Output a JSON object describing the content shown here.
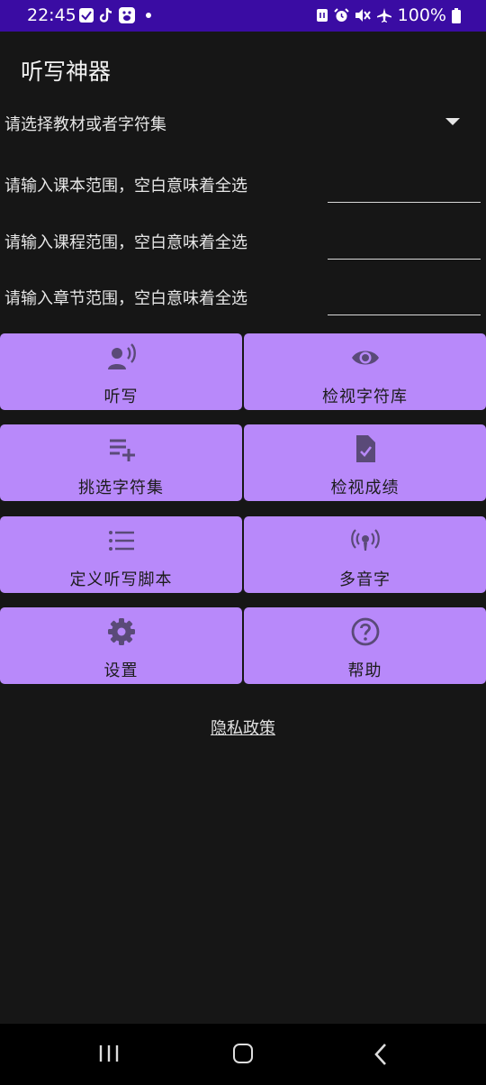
{
  "status_bar": {
    "time": "22:45",
    "battery": "100%",
    "left_icons": [
      "check-icon",
      "tiktok-icon",
      "baidu-icon",
      "dot-icon"
    ],
    "right_icons": [
      "nfc-icon",
      "alarm-icon",
      "mute-icon",
      "airplane-icon",
      "battery-icon"
    ]
  },
  "app": {
    "title": "听写神器"
  },
  "selector": {
    "label": "请选择教材或者字符集"
  },
  "ranges": [
    {
      "label": "请输入课本范围，空白意味着全选",
      "value": ""
    },
    {
      "label": "请输入课程范围，空白意味着全选",
      "value": ""
    },
    {
      "label": "请输入章节范围，空白意味着全选",
      "value": ""
    }
  ],
  "buttons": [
    {
      "label": "听写",
      "icon": "record-voice-icon"
    },
    {
      "label": "检视字符库",
      "icon": "eye-icon"
    },
    {
      "label": "挑选字符集",
      "icon": "playlist-add-icon"
    },
    {
      "label": "检视成绩",
      "icon": "file-check-icon"
    },
    {
      "label": "定义听写脚本",
      "icon": "list-icon"
    },
    {
      "label": "多音字",
      "icon": "podcast-icon"
    },
    {
      "label": "设置",
      "icon": "gear-icon"
    },
    {
      "label": "帮助",
      "icon": "help-circle-icon"
    }
  ],
  "privacy": {
    "label": "隐私政策"
  },
  "colors": {
    "accent": "#b889fa",
    "status_bar": "#3a0ca3",
    "background": "#161616"
  }
}
